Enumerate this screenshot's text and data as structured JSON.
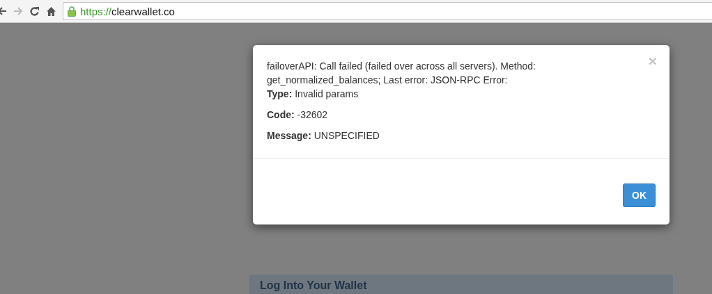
{
  "browser": {
    "url_scheme": "https://",
    "url_rest": "clearwallet.co",
    "secure": true,
    "back_enabled": true,
    "forward_enabled": false
  },
  "dialog": {
    "close": "×",
    "paragraphs": [
      [
        "failoverAPI: Call failed (failed over across all servers). Method: get_normalized_balances; Last error: JSON-RPC Error:",
        "**Type:** Invalid params"
      ],
      [
        "**Code:** -32602"
      ],
      [
        "**Message:** UNSPECIFIED"
      ]
    ],
    "buttons": [
      "OK"
    ]
  },
  "panel": {
    "title": "Log Into Your Wallet"
  }
}
